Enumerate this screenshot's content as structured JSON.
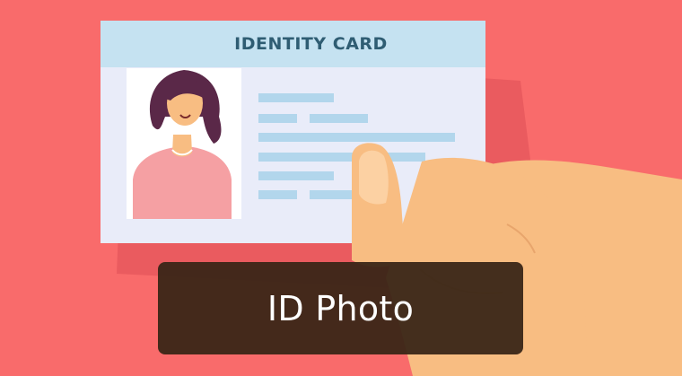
{
  "card": {
    "title": "IDENTITY CARD"
  },
  "caption": {
    "text": "ID Photo"
  },
  "colors": {
    "background": "#f96b6b",
    "background_shadow": "#ea5b5f",
    "card_header": "#c5e2f1",
    "card_body": "#e9ecf9",
    "text_lines": "#b2d6ec",
    "title_text": "#2f5d73",
    "skin": "#f8bd82",
    "hair": "#5a2848",
    "shirt": "#f5a0a3",
    "banner": "#3a2617"
  }
}
